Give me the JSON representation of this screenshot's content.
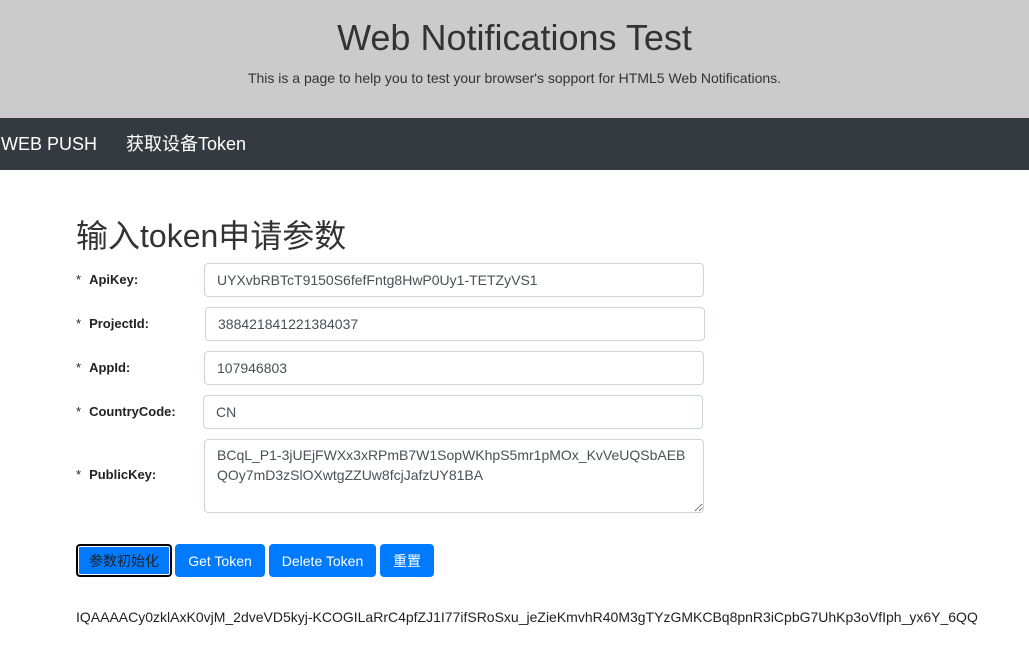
{
  "hero": {
    "title": "Web Notifications Test",
    "subtitle": "This is a page to help you to test your browser's sopport for HTML5 Web Notifications."
  },
  "nav": {
    "brand": "WEB PUSH",
    "token_link": "获取设备Token"
  },
  "form": {
    "title": "输入token申请参数",
    "required_mark": "*",
    "fields": {
      "apikey": {
        "label": "ApiKey:",
        "value": "UYXvbRBTcT9150S6fefFntg8HwP0Uy1-TETZyVS1"
      },
      "projectid": {
        "label": "ProjectId:",
        "value": "388421841221384037"
      },
      "appid": {
        "label": "AppId:",
        "value": "107946803"
      },
      "countrycode": {
        "label": "CountryCode:",
        "value": "CN"
      },
      "publickey": {
        "label": "PublicKey:",
        "value": "BCqL_P1-3jUEjFWXx3xRPmB7W1SopWKhpS5mr1pMOx_KvVeUQSbAEBQOy7mD3zSlOXwtgZZUw8fcjJafzUY81BA"
      }
    },
    "buttons": {
      "init": "参数初始化",
      "get_token": "Get Token",
      "delete_token": "Delete Token",
      "reset": "重置"
    }
  },
  "token_output": "IQAAAACy0zklAxK0vjM_2dveVD5kyj-KCOGILaRrC4pfZJ1I77ifSRoSxu_jeZieKmvhR40M3gTYzGMKCBq8pnR3iCpbG7UhKp3oVfIph_yx6Y_6QQ",
  "colors": {
    "hero_bg": "#cbcbcb",
    "navbar_bg": "#343a40",
    "primary": "#007bff"
  }
}
